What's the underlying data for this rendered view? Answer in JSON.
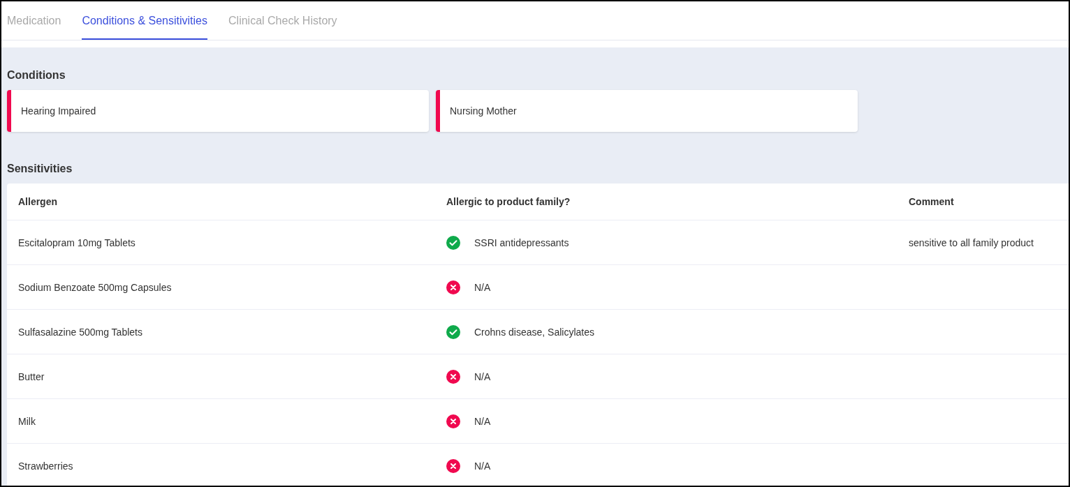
{
  "tabs": [
    {
      "label": "Medication",
      "selected": false
    },
    {
      "label": "Conditions & Sensitivities",
      "selected": true
    },
    {
      "label": "Clinical Check History",
      "selected": false
    }
  ],
  "conditions": {
    "title": "Conditions",
    "items": [
      {
        "label": "Hearing Impaired",
        "color": "#f0094f"
      },
      {
        "label": "Nursing Mother",
        "color": "#f0094f"
      }
    ]
  },
  "sensitivities": {
    "title": "Sensitivities",
    "columns": [
      "Allergen",
      "Allergic to product family?",
      "Comment"
    ],
    "rows": [
      {
        "allergen": "Escitalopram 10mg Tablets",
        "family_allergic": true,
        "family": "SSRI antidepressants",
        "comment": "sensitive to all family product"
      },
      {
        "allergen": "Sodium Benzoate 500mg Capsules",
        "family_allergic": false,
        "family": "N/A"
      },
      {
        "allergen": "Sulfasalazine 500mg Tablets",
        "family_allergic": true,
        "family": "Crohns disease, Salicylates"
      },
      {
        "allergen": "Butter",
        "family_allergic": false,
        "family": "N/A"
      },
      {
        "allergen": "Milk",
        "family_allergic": false,
        "family": "N/A"
      },
      {
        "allergen": "Strawberries",
        "family_allergic": false,
        "family": "N/A"
      }
    ]
  }
}
